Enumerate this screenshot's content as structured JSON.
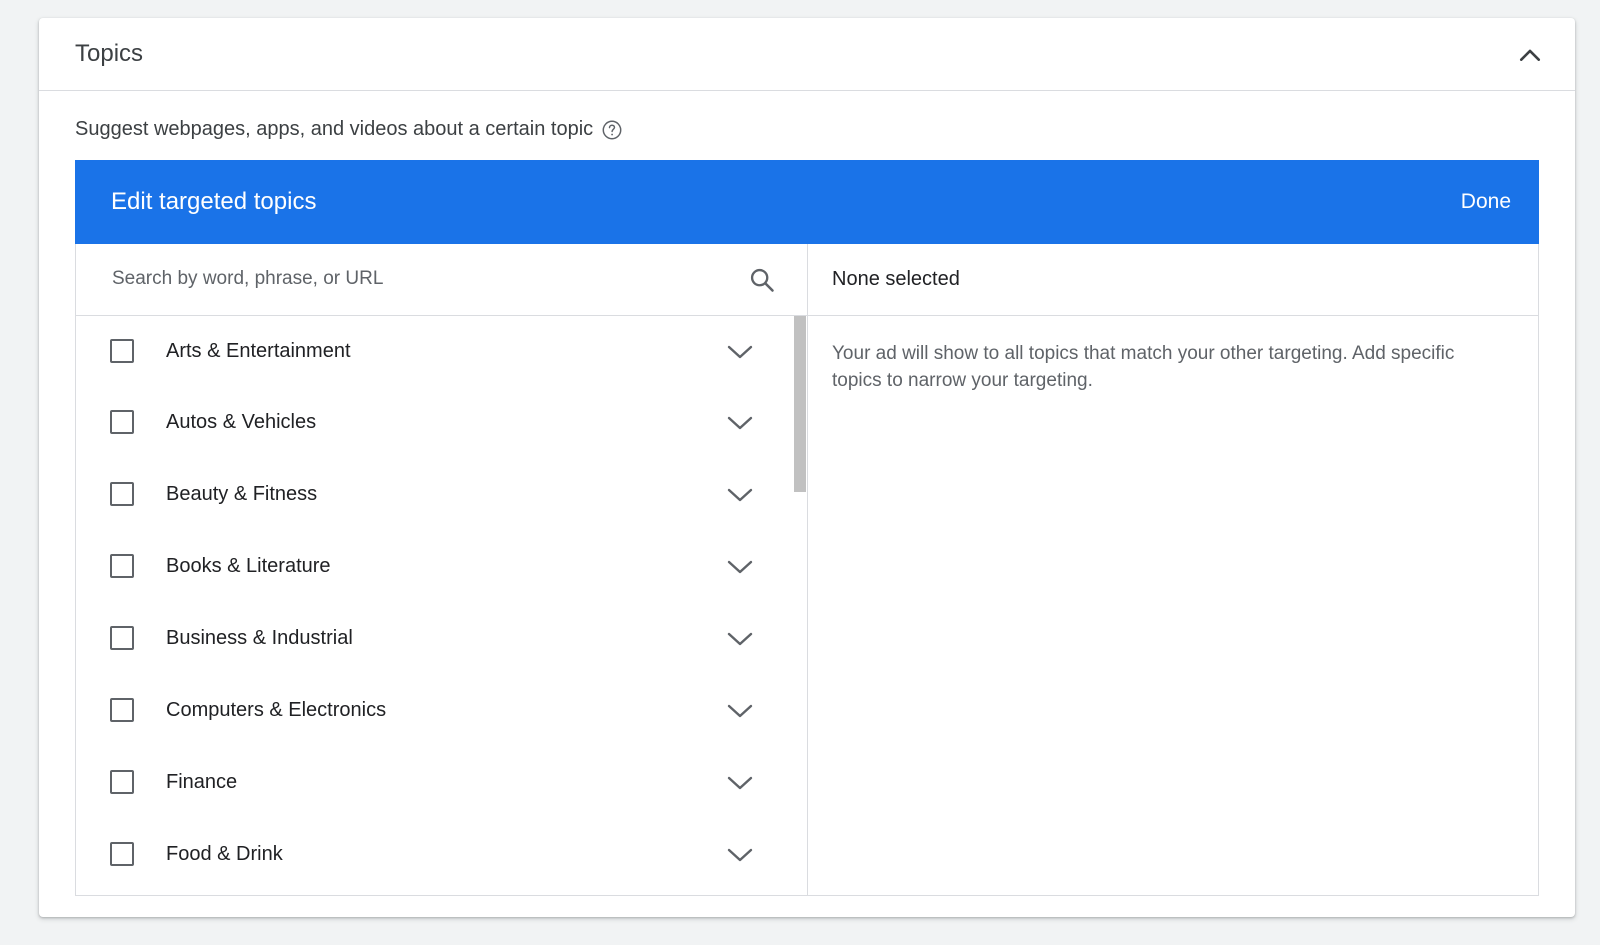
{
  "card": {
    "title": "Topics",
    "collapse_icon": "chevron-up-icon"
  },
  "subtitle": {
    "text": "Suggest webpages, apps, and videos about a certain topic",
    "help_icon": "help-circle-icon"
  },
  "editor": {
    "title": "Edit targeted topics",
    "done_label": "Done",
    "accent_color": "#1a73e8"
  },
  "search": {
    "placeholder": "Search by word, phrase, or URL",
    "value": "",
    "icon": "search-icon"
  },
  "topics": [
    {
      "label": "Arts & Entertainment",
      "checked": false
    },
    {
      "label": "Autos & Vehicles",
      "checked": false
    },
    {
      "label": "Beauty & Fitness",
      "checked": false
    },
    {
      "label": "Books & Literature",
      "checked": false
    },
    {
      "label": "Business & Industrial",
      "checked": false
    },
    {
      "label": "Computers & Electronics",
      "checked": false
    },
    {
      "label": "Finance",
      "checked": false
    },
    {
      "label": "Food & Drink",
      "checked": false
    }
  ],
  "selected_panel": {
    "header": "None selected",
    "note": "Your ad will show to all topics that match your other targeting. Add specific topics to narrow your targeting."
  }
}
